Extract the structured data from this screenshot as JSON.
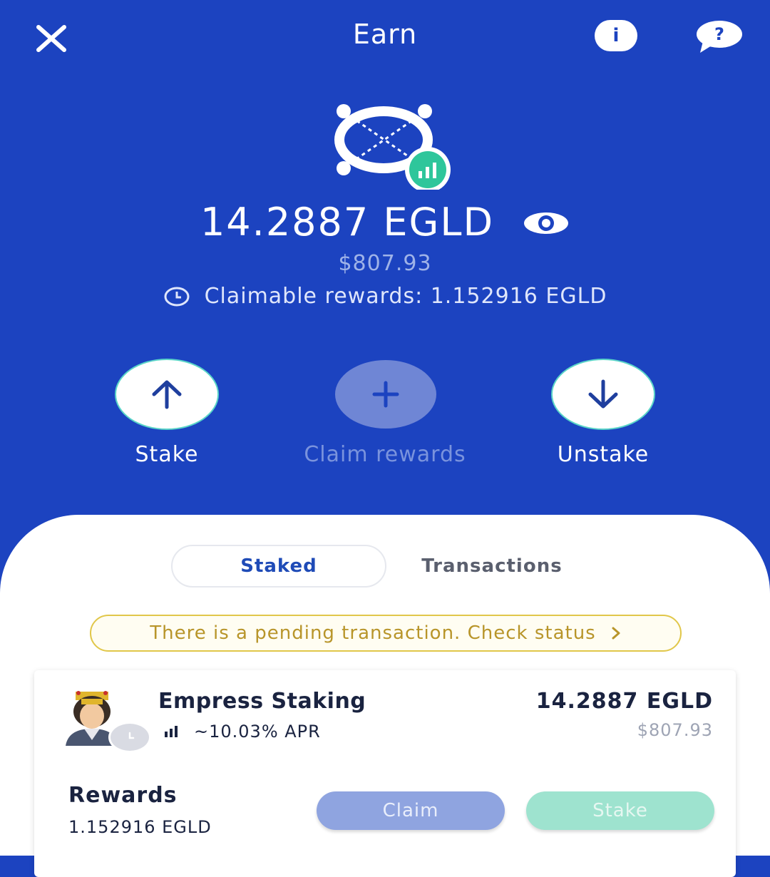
{
  "header": {
    "title": "Earn",
    "info_label": "i",
    "help_label": "?"
  },
  "token": {
    "balance": "14.2887 EGLD",
    "usd_value": "$807.93",
    "claimable": "Claimable rewards: 1.152916 EGLD"
  },
  "actions": {
    "stake": "Stake",
    "claim_rewards": "Claim rewards",
    "unstake": "Unstake"
  },
  "tabs": {
    "staked": "Staked",
    "transactions": "Transactions"
  },
  "pending_notice": "There is a pending transaction. Check status",
  "staking_card": {
    "provider": "Empress Staking",
    "apr": "~10.03% APR",
    "amount": "14.2887 EGLD",
    "amount_usd": "$807.93",
    "rewards_label": "Rewards",
    "rewards_value": "1.152916 EGLD",
    "claim_button": "Claim",
    "stake_button": "Stake"
  },
  "colors": {
    "background": "#1c43c0",
    "accent_green": "#2ec69b",
    "pending_border": "#e1c74a"
  }
}
